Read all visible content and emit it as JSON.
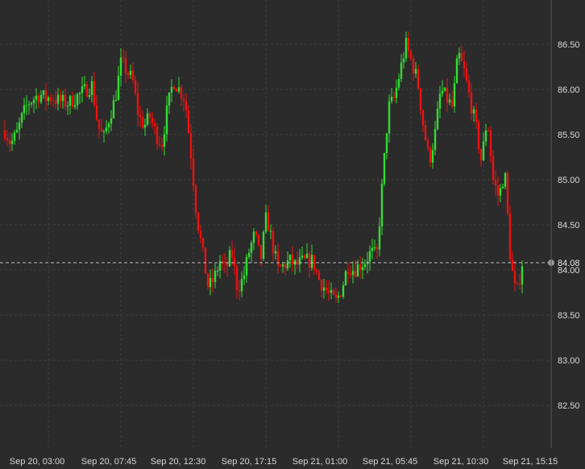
{
  "chart_data": {
    "type": "candlestick",
    "title": "",
    "xlabel": "",
    "ylabel": "",
    "grid": true,
    "ylim": [
      82.0,
      87.0
    ],
    "y_ticks": [
      "82.50",
      "83.00",
      "83.50",
      "84.00",
      "84.50",
      "85.00",
      "85.50",
      "86.00",
      "86.50"
    ],
    "y_tick_values": [
      82.5,
      83.0,
      83.5,
      84.0,
      84.5,
      85.0,
      85.5,
      86.0,
      86.5
    ],
    "x_ticks": [
      "Sep 20, 03:00",
      "Sep 20, 07:45",
      "Sep 20, 12:30",
      "Sep 20, 17:15",
      "Sep 21, 01:00",
      "Sep 21, 05:45",
      "Sep 21, 10:30",
      "Sep 21, 15:15"
    ],
    "current_price": {
      "label": "84.08",
      "value": 84.08
    },
    "colors": {
      "up": "#33dd33",
      "down": "#ee1111",
      "grid": "#3c3c3c",
      "background": "#2b2b2b"
    },
    "close_path": [
      85.55,
      85.4,
      85.5,
      85.7,
      85.85,
      85.9,
      85.95,
      85.9,
      85.92,
      85.88,
      85.86,
      85.85,
      85.9,
      85.95,
      86.0,
      86.05,
      85.6,
      85.45,
      85.7,
      85.9,
      86.3,
      86.2,
      86.1,
      85.7,
      85.6,
      85.7,
      85.5,
      85.4,
      85.8,
      86.1,
      86.0,
      85.9,
      85.3,
      84.6,
      84.2,
      83.8,
      83.9,
      84.1,
      84.0,
      84.2,
      83.8,
      83.9,
      84.2,
      84.4,
      84.1,
      84.6,
      84.3,
      84.0,
      84.05,
      84.1,
      84.05,
      84.08,
      84.1,
      84.1,
      83.9,
      83.8,
      83.7,
      83.65,
      83.8,
      84.05,
      84.0,
      84.05,
      84.1,
      84.2,
      84.15,
      85.0,
      85.8,
      85.9,
      86.2,
      86.5,
      86.3,
      86.1,
      85.6,
      85.2,
      85.5,
      86.0,
      85.9,
      85.8,
      86.4,
      86.2,
      85.9,
      85.6,
      85.2,
      85.7,
      85.0,
      84.8,
      85.1,
      84.1,
      83.7,
      84.08
    ]
  }
}
